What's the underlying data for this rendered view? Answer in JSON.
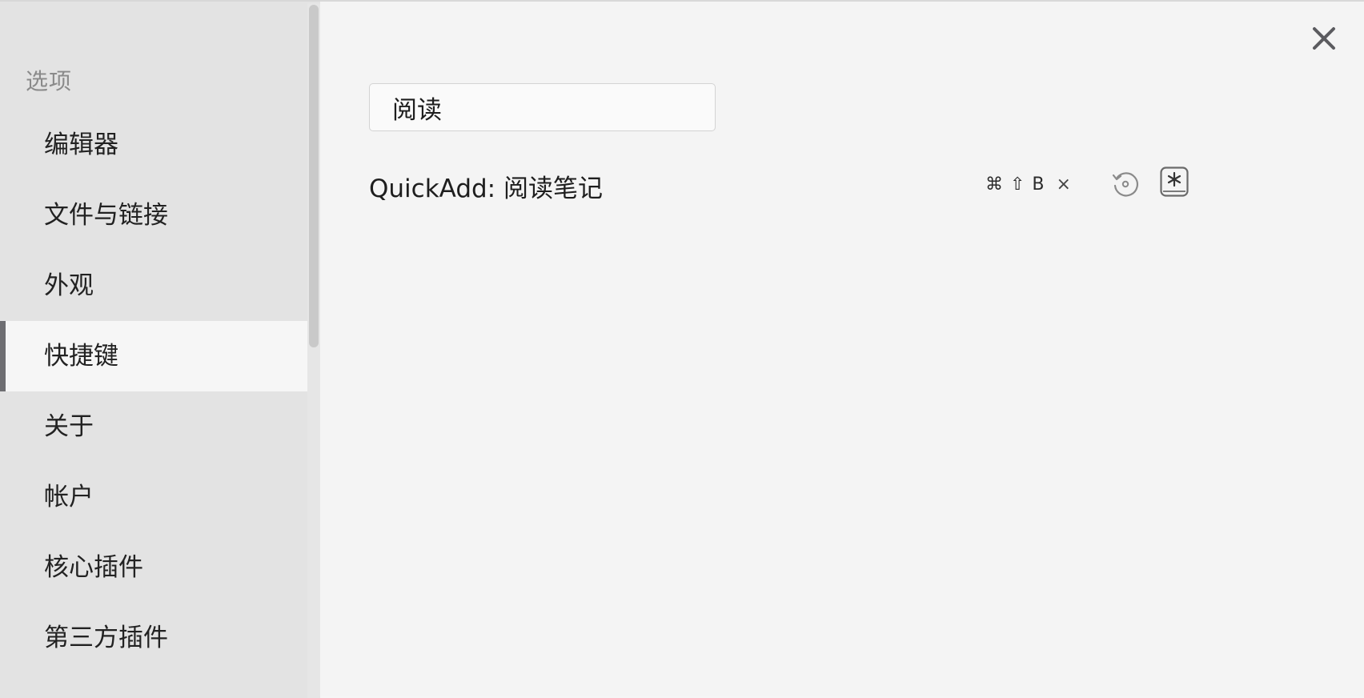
{
  "sidebar": {
    "heading": "选项",
    "items": [
      {
        "label": "编辑器",
        "active": false
      },
      {
        "label": "文件与链接",
        "active": false
      },
      {
        "label": "外观",
        "active": false
      },
      {
        "label": "快捷键",
        "active": true
      },
      {
        "label": "关于",
        "active": false
      },
      {
        "label": "帐户",
        "active": false
      },
      {
        "label": "核心插件",
        "active": false
      },
      {
        "label": "第三方插件",
        "active": false
      }
    ]
  },
  "search": {
    "value": "阅读"
  },
  "hotkeys": [
    {
      "command": "QuickAdd: 阅读笔记",
      "keys": "⌘ ⇧ B",
      "remove_glyph": "×"
    }
  ],
  "icons": {
    "close": "close-icon",
    "restore": "restore-default-icon",
    "add": "add-hotkey-icon"
  },
  "colors": {
    "sidebar_bg": "#e3e3e3",
    "main_bg": "#f4f4f4",
    "active_item_bg": "#f6f6f6",
    "active_indicator": "#6e6e72"
  }
}
